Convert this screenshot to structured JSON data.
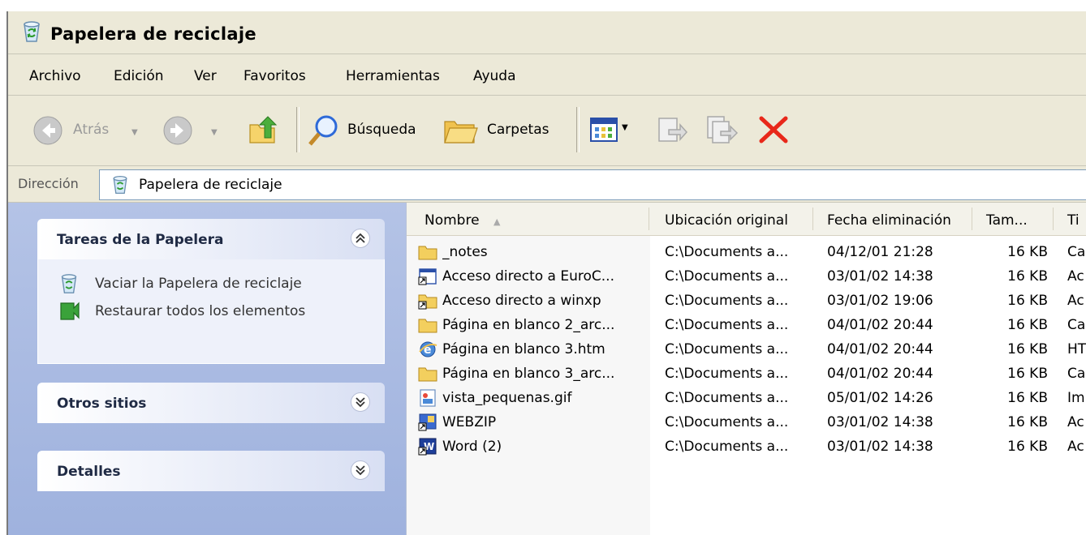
{
  "window": {
    "title": "Papelera de reciclaje"
  },
  "menu": [
    "Archivo",
    "Edición",
    "Ver",
    "Favoritos",
    "Herramientas",
    "Ayuda"
  ],
  "toolbar": {
    "back_label": "Atrás",
    "search_label": "Búsqueda",
    "folders_label": "Carpetas",
    "delete_color": "#e8281a"
  },
  "address": {
    "label": "Dirección",
    "value": "Papelera de reciclaje"
  },
  "sidebar": {
    "panels": [
      {
        "title": "Tareas de la Papelera",
        "items": [
          "Vaciar la Papelera de reciclaje",
          "Restaurar todos los elementos"
        ]
      },
      {
        "title": "Otros sitios"
      },
      {
        "title": "Detalles"
      }
    ]
  },
  "table": {
    "columns": [
      "Nombre",
      "Ubicación original",
      "Fecha eliminación",
      "Tam...",
      "Ti"
    ],
    "rows": [
      {
        "icon": "folder-icon",
        "name": "_notes",
        "location": "C:\\Documents a...",
        "date": "04/12/01 21:28",
        "size": "16 KB",
        "type": "Ca"
      },
      {
        "icon": "shortcut-icon",
        "name": "Acceso directo a EuroC...",
        "location": "C:\\Documents a...",
        "date": "03/01/02 14:38",
        "size": "16 KB",
        "type": "Ac"
      },
      {
        "icon": "folder-shortcut-icon",
        "name": "Acceso directo a winxp",
        "location": "C:\\Documents a...",
        "date": "03/01/02 19:06",
        "size": "16 KB",
        "type": "Ac"
      },
      {
        "icon": "folder-icon",
        "name": "Página en blanco 2_arc...",
        "location": "C:\\Documents a...",
        "date": "04/01/02 20:44",
        "size": "16 KB",
        "type": "Ca"
      },
      {
        "icon": "ie-icon",
        "name": "Página en blanco 3.htm",
        "location": "C:\\Documents a...",
        "date": "04/01/02 20:44",
        "size": "16 KB",
        "type": "HT"
      },
      {
        "icon": "folder-icon",
        "name": "Página en blanco 3_arc...",
        "location": "C:\\Documents a...",
        "date": "04/01/02 20:44",
        "size": "16 KB",
        "type": "Ca"
      },
      {
        "icon": "image-icon",
        "name": "vista_pequenas.gif",
        "location": "C:\\Documents a...",
        "date": "05/01/02 14:26",
        "size": "16 KB",
        "type": "Im"
      },
      {
        "icon": "app-shortcut-icon",
        "name": "WEBZIP",
        "location": "C:\\Documents a...",
        "date": "03/01/02 14:38",
        "size": "16 KB",
        "type": "Ac"
      },
      {
        "icon": "word-shortcut-icon",
        "name": "Word (2)",
        "location": "C:\\Documents a...",
        "date": "03/01/02 14:38",
        "size": "16 KB",
        "type": "Ac"
      }
    ]
  }
}
